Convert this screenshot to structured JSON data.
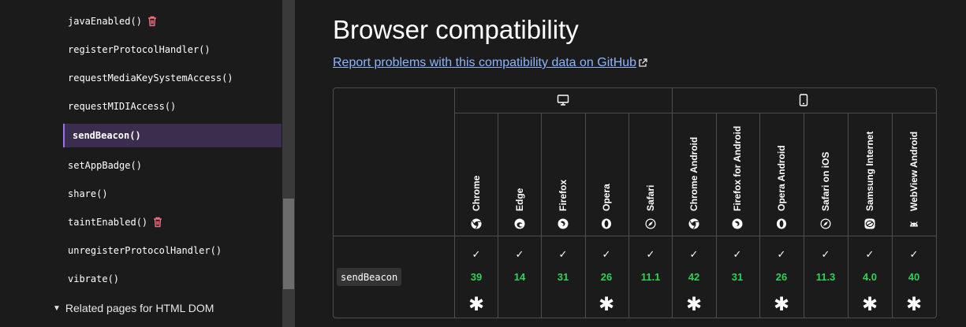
{
  "sidebar": {
    "items": [
      {
        "label": "javaEnabled()",
        "deprecated": true
      },
      {
        "label": "registerProtocolHandler()"
      },
      {
        "label": "requestMediaKeySystemAccess()"
      },
      {
        "label": "requestMIDIAccess()"
      },
      {
        "label": "sendBeacon()",
        "active": true
      },
      {
        "label": "setAppBadge()"
      },
      {
        "label": "share()"
      },
      {
        "label": "taintEnabled()",
        "deprecated": true
      },
      {
        "label": "unregisterProtocolHandler()"
      },
      {
        "label": "vibrate()"
      }
    ],
    "related": "Related pages for HTML DOM"
  },
  "main": {
    "title": "Browser compatibility",
    "report_link": "Report problems with this compatibility data on GitHub",
    "table": {
      "platforms": [
        {
          "name": "desktop",
          "icon": "desktop-icon"
        },
        {
          "name": "mobile",
          "icon": "mobile-icon"
        }
      ],
      "browsers": [
        {
          "name": "Chrome",
          "icon": "chrome-icon",
          "version": "39",
          "asterisk": true
        },
        {
          "name": "Edge",
          "icon": "edge-icon",
          "version": "14",
          "asterisk": false
        },
        {
          "name": "Firefox",
          "icon": "firefox-icon",
          "version": "31",
          "asterisk": false
        },
        {
          "name": "Opera",
          "icon": "opera-icon",
          "version": "26",
          "asterisk": true
        },
        {
          "name": "Safari",
          "icon": "safari-icon",
          "version": "11.1",
          "asterisk": false
        },
        {
          "name": "Chrome Android",
          "icon": "chrome-icon",
          "version": "42",
          "asterisk": true
        },
        {
          "name": "Firefox for Android",
          "icon": "firefox-icon",
          "version": "31",
          "asterisk": false
        },
        {
          "name": "Opera Android",
          "icon": "opera-icon",
          "version": "26",
          "asterisk": true
        },
        {
          "name": "Safari on iOS",
          "icon": "safari-icon",
          "version": "11.3",
          "asterisk": false
        },
        {
          "name": "Samsung Internet",
          "icon": "samsung-icon",
          "version": "4.0",
          "asterisk": true
        },
        {
          "name": "WebView Android",
          "icon": "android-icon",
          "version": "40",
          "asterisk": true
        }
      ],
      "feature": "sendBeacon",
      "check_glyph": "✓",
      "asterisk_glyph": "✱",
      "support_color": "#30d158"
    }
  }
}
